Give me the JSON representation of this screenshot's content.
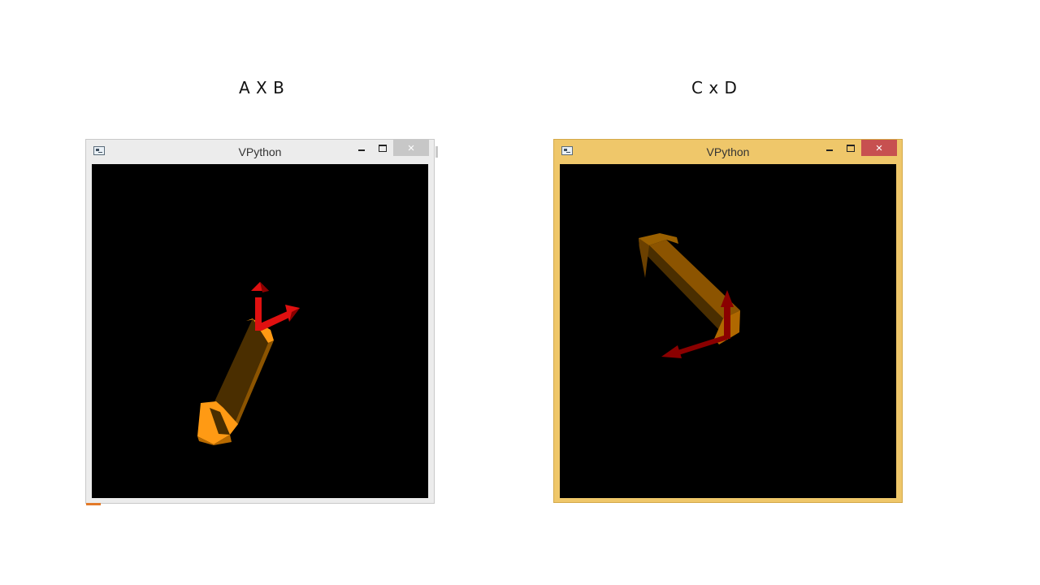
{
  "captions": {
    "left": "A X B",
    "right": "C x D"
  },
  "windows": [
    {
      "title": "VPython",
      "state": "inactive",
      "frame_color": "#ececec",
      "close_color": "#c7c7c7",
      "buttons": {
        "minimize": "minimize-icon",
        "maximize": "maximize-icon",
        "close": "×"
      }
    },
    {
      "title": "VPython",
      "state": "active",
      "frame_color": "#efc76a",
      "close_color": "#c75050",
      "buttons": {
        "minimize": "minimize-icon",
        "maximize": "maximize-icon",
        "close": "×"
      }
    }
  ],
  "scene_colors": {
    "background": "#000000",
    "bar": "#ff9a14",
    "arrow": "#e01010",
    "arrow_dark": "#8a0000"
  }
}
